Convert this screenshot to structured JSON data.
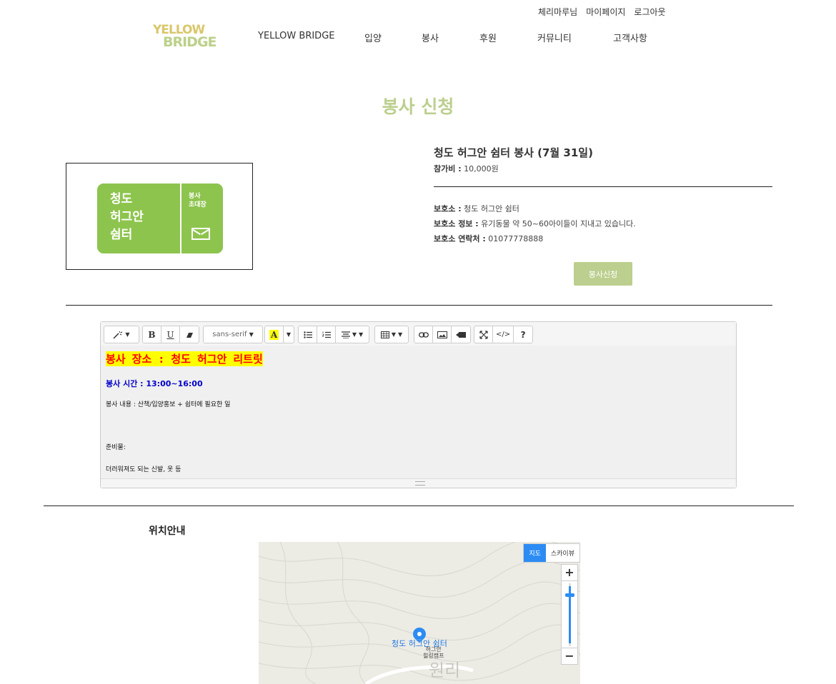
{
  "header": {
    "utility_links": [
      "체리마루님",
      "마이페이지",
      "로그아웃"
    ],
    "logo": {
      "line1": "YELLOW",
      "line2": "BRIDGE"
    },
    "nav": [
      "YELLOW BRIDGE",
      "입양",
      "봉사",
      "후원",
      "커뮤니티",
      "고객사항"
    ]
  },
  "page_title": "봉사 신청",
  "thumbnail": {
    "ticket_text": "청도\n허그안\n쉼터",
    "ticket_side": "봉사\n초대장"
  },
  "volunteer": {
    "title": "청도 허그안 쉼터 봉사 (7월 31일)",
    "fee_label": "참가비 :",
    "fee_value": "10,000원",
    "shelter_label": "보호소 :",
    "shelter_value": "청도 허그안 쉼터",
    "shelter_info_label": "보호소 정보 :",
    "shelter_info_value": "유기동물 약 50~60아이들이 지내고 있습니다.",
    "contact_label": "보호소 연락처 :",
    "contact_value": "01077778888",
    "apply_button": "봉사신청"
  },
  "editor": {
    "toolbar": {
      "font_name": "sans-serif"
    },
    "content": {
      "line1": "봉사 장소 : 청도 허그안 리트릿",
      "line2": "봉사 시간 : 13:00~16:00",
      "line3": "봉사 내용 : 산책/입양홍보 + 쉼터에 필요한 일",
      "line4": "준비물:",
      "line5": "더러워져도 되는 신발, 옷 등"
    },
    "colors": {
      "highlight": "#ffff00",
      "line1_text": "#ff0000",
      "line2_text": "#0000cc"
    }
  },
  "location": {
    "heading": "위치안내",
    "map_type_map": "지도",
    "map_type_sky": "스카이뷰",
    "marker_label": "청도 허그안 쉼터",
    "place_label": "허그안\n힐링캠프",
    "area_label": "원리",
    "zoom_in": "+",
    "zoom_out": "−"
  },
  "theme": {
    "accent": "#bccf8e",
    "marker": "#2c8cf4"
  }
}
